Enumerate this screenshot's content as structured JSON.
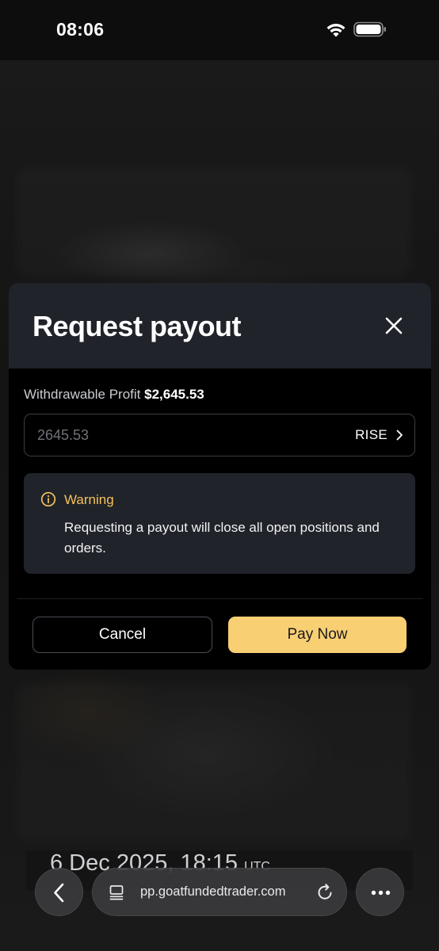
{
  "status_bar": {
    "time": "08:06"
  },
  "modal": {
    "title": "Request payout",
    "profit_label": "Withdrawable Profit",
    "profit_value": "$2,645.53",
    "amount_placeholder": "2645.53",
    "method_label": "RISE",
    "warning": {
      "title": "Warning",
      "text": "Requesting a payout will close all open positions and orders."
    },
    "cancel_label": "Cancel",
    "pay_label": "Pay Now"
  },
  "background": {
    "date": "6 Dec 2025, 18:15",
    "timezone": "UTC"
  },
  "browser": {
    "url": "pp.goatfundedtrader.com"
  },
  "colors": {
    "accent": "#f9cf74",
    "warning": "#f5c15c",
    "modal_header": "#202329"
  },
  "icons": {
    "close": "close-icon",
    "info": "info-icon",
    "chevron": "chevron-right-icon",
    "back": "chevron-left-icon",
    "tabs": "tabs-icon",
    "reload": "reload-icon",
    "more": "more-icon"
  }
}
